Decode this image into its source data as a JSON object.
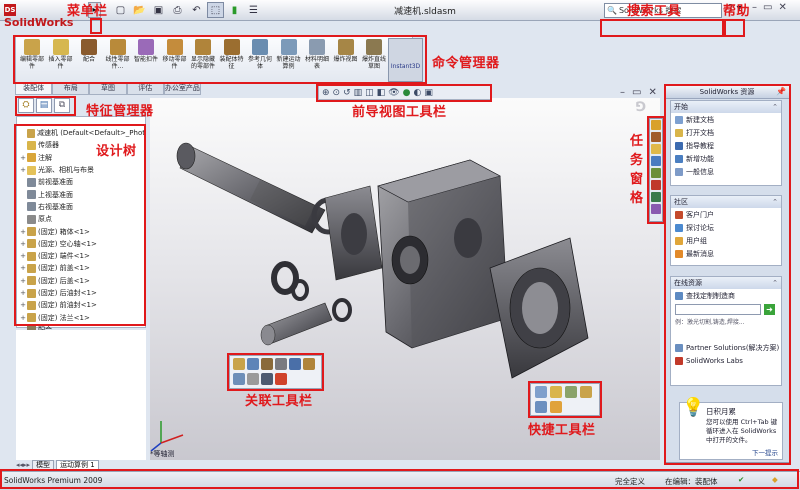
{
  "app": {
    "logo_text": "SolidWorks",
    "document_title": "减速机.sldasm"
  },
  "search": {
    "placeholder": "SolidWorks 搜索"
  },
  "help_label": "?",
  "annotations": {
    "menu_bar": "菜单栏",
    "search_tool": "搜索工具",
    "help": "帮助",
    "command_manager": "命令管理器",
    "feature_manager": "特征管理器",
    "design_tree": "设计树",
    "heads_up_toolbar": "前导视图工具栏",
    "task_pane": "任务窗格",
    "context_toolbar": "关联工具栏",
    "shortcut_bar": "快捷工具栏"
  },
  "command_manager": {
    "buttons": [
      {
        "label": "编辑零部件",
        "icon": "edit-component-icon",
        "color": "#c9a34a"
      },
      {
        "label": "插入零部件",
        "icon": "insert-component-icon",
        "color": "#d6b74f"
      },
      {
        "label": "配合",
        "icon": "mate-icon",
        "color": "#8a5b2e"
      },
      {
        "label": "线性零部件...",
        "icon": "linear-pattern-icon",
        "color": "#b98a3a"
      },
      {
        "label": "智能扣件",
        "icon": "smart-fastener-icon",
        "color": "#9a6ab8"
      },
      {
        "label": "移动零部件",
        "icon": "move-component-icon",
        "color": "#c48c3c"
      },
      {
        "label": "显示隐藏的零部件",
        "icon": "show-hidden-icon",
        "color": "#b0843a"
      },
      {
        "label": "装配体特征",
        "icon": "assembly-feature-icon",
        "color": "#9b6e30"
      },
      {
        "label": "参考几何体",
        "icon": "reference-geometry-icon",
        "color": "#6a8db0"
      },
      {
        "label": "新建运动算例",
        "icon": "new-motion-study-icon",
        "color": "#7c9ab9"
      },
      {
        "label": "材料明细表",
        "icon": "bom-icon",
        "color": "#8a9bb0"
      },
      {
        "label": "爆炸视图",
        "icon": "exploded-view-icon",
        "color": "#a68646"
      },
      {
        "label": "爆炸直线草图",
        "icon": "explode-line-sketch-icon",
        "color": "#8b7950"
      }
    ],
    "instant3d": "Instant3D",
    "tabs": [
      "装配体",
      "布局",
      "草图",
      "评估",
      "办公室产品"
    ]
  },
  "feature_tabs": [
    "feature-manager-icon",
    "property-manager-icon",
    "config-manager-icon"
  ],
  "design_tree": {
    "items": [
      {
        "label": "减速机  (Default<Default>_Phot",
        "expand": "",
        "color": "#c9a34a"
      },
      {
        "label": "传感器",
        "expand": "",
        "color": "#d9b54a"
      },
      {
        "label": "注解",
        "expand": "+",
        "color": "#d9a63a"
      },
      {
        "label": "光源、相机与布景",
        "expand": "+",
        "color": "#e4c25a"
      },
      {
        "label": "前视基准面",
        "expand": "",
        "color": "#7f8a99"
      },
      {
        "label": "上视基准面",
        "expand": "",
        "color": "#7f8a99"
      },
      {
        "label": "右视基准面",
        "expand": "",
        "color": "#7f8a99"
      },
      {
        "label": "原点",
        "expand": "",
        "color": "#8a8a8a"
      },
      {
        "label": "(固定) 箱体<1>",
        "expand": "+",
        "color": "#c9a34a"
      },
      {
        "label": "(固定) 空心轴<1>",
        "expand": "+",
        "color": "#c9a34a"
      },
      {
        "label": "(固定) 端件<1>",
        "expand": "+",
        "color": "#c9a34a"
      },
      {
        "label": "(固定) 前盖<1>",
        "expand": "+",
        "color": "#c9a34a"
      },
      {
        "label": "(固定) 后盖<1>",
        "expand": "+",
        "color": "#c9a34a"
      },
      {
        "label": "(固定) 后油封<1>",
        "expand": "+",
        "color": "#c9a34a"
      },
      {
        "label": "(固定) 前油封<1>",
        "expand": "+",
        "color": "#c9a34a"
      },
      {
        "label": "(固定) 法兰<1>",
        "expand": "+",
        "color": "#c9a34a"
      },
      {
        "label": "配合",
        "expand": "",
        "color": "#8a7a5a"
      }
    ]
  },
  "task_pane": {
    "title": "SolidWorks 资源",
    "sections": [
      {
        "title": "开始",
        "items": [
          {
            "label": "新建文档",
            "color": "#7da0d0"
          },
          {
            "label": "打开文档",
            "color": "#d9b54a"
          },
          {
            "label": "指导教程",
            "color": "#3c6bb0"
          },
          {
            "label": "新增功能",
            "color": "#4b7fc1"
          },
          {
            "label": "一般信息",
            "color": "#7e9bc8"
          }
        ]
      },
      {
        "title": "社区",
        "items": [
          {
            "label": "客户门户",
            "color": "#c44a2c"
          },
          {
            "label": "探讨论坛",
            "color": "#4c8ad0"
          },
          {
            "label": "用户组",
            "color": "#e0a63a"
          },
          {
            "label": "最新消息",
            "color": "#e28a2a"
          }
        ]
      },
      {
        "title": "在线资源",
        "items": [
          {
            "label": "查找定制制造商",
            "color": "#5d8ac2"
          }
        ]
      }
    ],
    "online": {
      "hint": "例：激光切割,铸造,焊接...",
      "links": [
        {
          "label": "Partner Solutions(解决方案)",
          "color": "#6a8fc0"
        },
        {
          "label": "SolidWorks Labs",
          "color": "#c23a2a"
        }
      ]
    },
    "tip": {
      "title": "日积月累",
      "text": "您可以使用 Ctrl+Tab 键循环进入在 SolidWorks 中打开的文件。",
      "next": "下一提示"
    }
  },
  "viewport": {
    "orientation": "*等轴测"
  },
  "bottom_tabs": [
    "模型",
    "运动算例 1"
  ],
  "status": {
    "product": "SolidWorks Premium 2009",
    "state": "完全定义",
    "editing": "在编辑：装配体"
  }
}
